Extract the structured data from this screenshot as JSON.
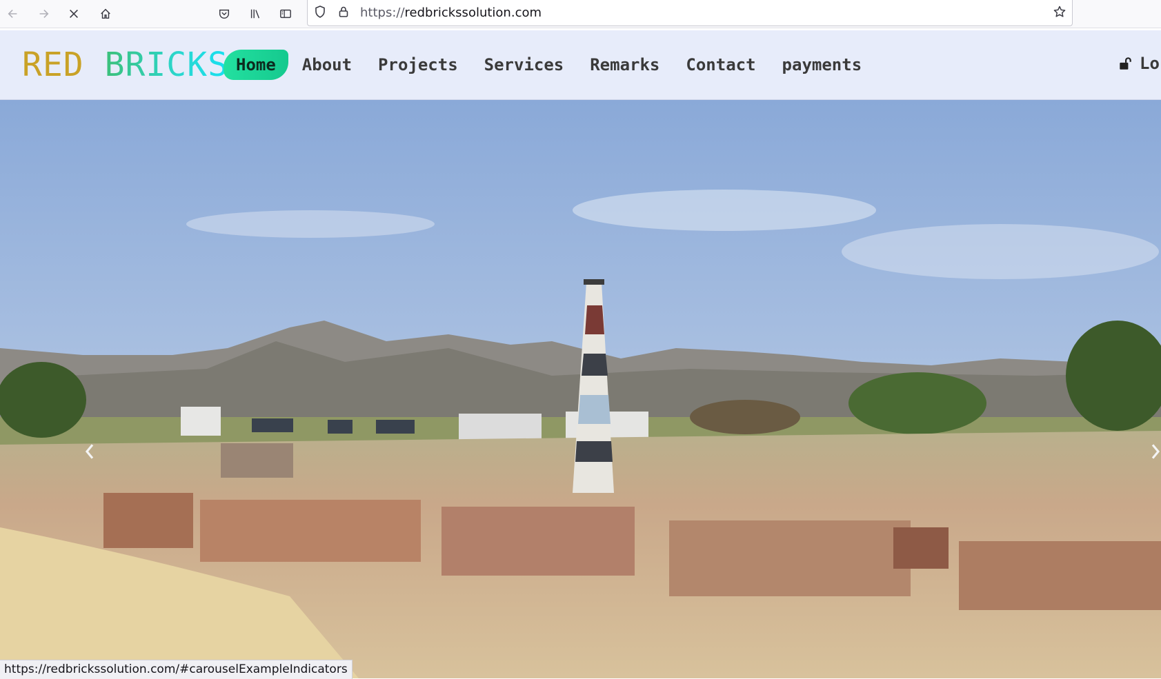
{
  "browser": {
    "url_protocol": "https://",
    "url_host": "redbrickssolution.com",
    "status_url": "https://redbrickssolution.com/#carouselExampleIndicators"
  },
  "site": {
    "brand_part1": "RED",
    "brand_part2": "BRICKS",
    "nav": [
      {
        "label": "Home",
        "active": true
      },
      {
        "label": "About"
      },
      {
        "label": "Projects"
      },
      {
        "label": "Services"
      },
      {
        "label": "Remarks"
      },
      {
        "label": "Contact"
      },
      {
        "label": "payments"
      }
    ],
    "login_label": "Lo"
  },
  "colors": {
    "nav_bg": "#e7ecfa",
    "active_pill": "#23e0a0",
    "brand_red_text": "#c9a227",
    "brand_bricks_start": "#3cc07a",
    "brand_bricks_end": "#17e0f2"
  },
  "hero": {
    "image_alt": "brick kiln chimney with mountains"
  }
}
